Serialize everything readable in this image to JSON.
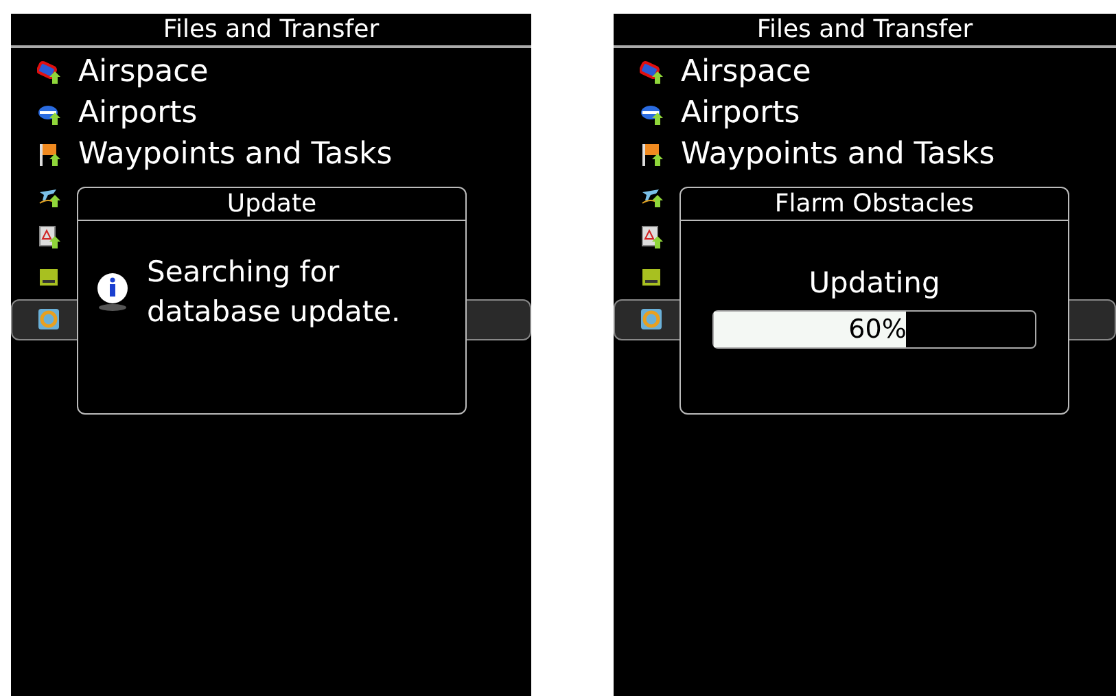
{
  "screens": [
    {
      "title": "Files and Transfer",
      "items": [
        {
          "label": "Airspace",
          "selected": false
        },
        {
          "label": "Airports",
          "selected": false
        },
        {
          "label": "Waypoints and Tasks",
          "selected": false
        },
        {
          "selected": false
        },
        {
          "selected": false
        },
        {
          "selected": false
        },
        {
          "selected": true
        }
      ],
      "dialog": {
        "kind": "message",
        "title": "Update",
        "message": "Searching for database update."
      }
    },
    {
      "title": "Files and Transfer",
      "items": [
        {
          "label": "Airspace",
          "selected": false
        },
        {
          "label": "Airports",
          "selected": false
        },
        {
          "label": "Waypoints and Tasks",
          "selected": false
        },
        {
          "selected": false
        },
        {
          "selected": false
        },
        {
          "selected": false
        },
        {
          "selected": true
        }
      ],
      "dialog": {
        "kind": "progress",
        "title": "Flarm Obstacles",
        "status": "Updating",
        "level": 0.6,
        "reading": "60%"
      }
    }
  ]
}
